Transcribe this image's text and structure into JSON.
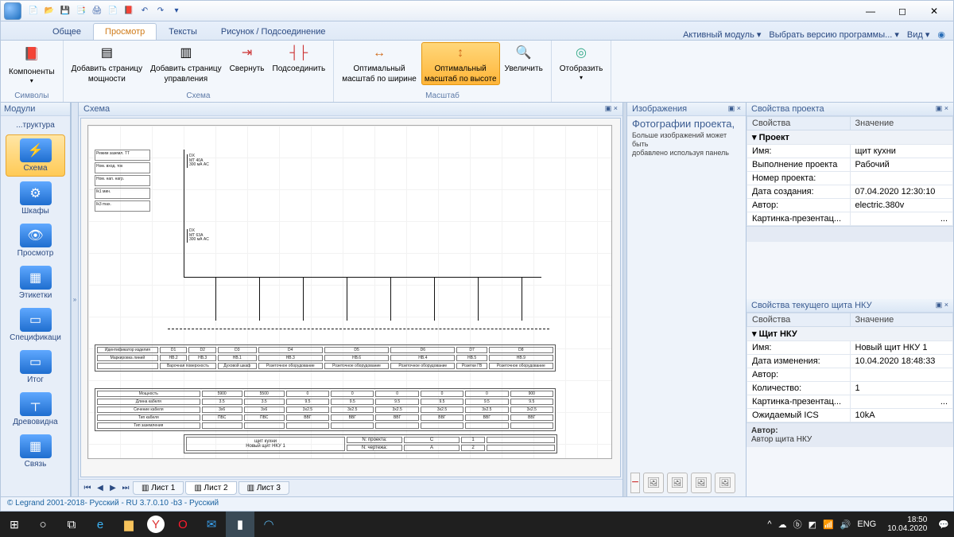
{
  "titlebar": {
    "qat": [
      "📄",
      "📂",
      "💾",
      "📑",
      "🖨",
      "📄",
      "📕",
      "↶",
      "↷"
    ]
  },
  "tabs": {
    "t1": "Общее",
    "t2": "Просмотр",
    "t3": "Тексты",
    "t4": "Рисунок / Подсоединение"
  },
  "tabright": {
    "a": "Активный модуль",
    "b": "Выбрать версию программы...",
    "c": "Вид"
  },
  "ribbon": {
    "g1": {
      "label": "Символы",
      "btn1top": "Компоненты",
      "btn1bot": ""
    },
    "g2": {
      "label": "Схема",
      "b1a": "Добавить страницу",
      "b1b": "мощности",
      "b2a": "Добавить страницу",
      "b2b": "управления",
      "b3": "Свернуть",
      "b4": "Подсоединить"
    },
    "g3": {
      "label": "Масштаб",
      "b1a": "Оптимальный",
      "b1b": "масштаб по ширине",
      "b2a": "Оптимальный",
      "b2b": "масштаб по высоте",
      "b3": "Увеличить"
    },
    "g4": {
      "b1": "Отобразить"
    }
  },
  "modules": {
    "title": "Модули",
    "m0": "...труктура",
    "m1": "Схема",
    "m2": "Шкафы",
    "m3": "Просмотр",
    "m4": "Этикетки",
    "m5": "Спецификаци",
    "m6": "Итог",
    "m7": "Древовидна",
    "m8": "Связь"
  },
  "center": {
    "title": "Схема",
    "sheet1": "Лист 1",
    "sheet2": "Лист 2",
    "sheet3": "Лист 3",
    "tb_name": "щит кухни",
    "tb_sub": "Новый щит НКУ 1",
    "tb_np": "N: проекта:",
    "tb_nc": "N: чертежа:",
    "side0": "Режим заземл.    TT",
    "side1": "Ном. вход. ток",
    "side2": "Ном. нап. нагр.",
    "side3": "Ik1 мин.",
    "side4": "Ik3 max.",
    "col0": "Идентификатор изделия",
    "col1": "Маркировка линий",
    "col2": "",
    "col3": "Мощность",
    "col4": "Длина кабеля",
    "col5": "Сечение кабеля",
    "col6": "Тип кабеля",
    "col7": "Тип заземления"
  },
  "images": {
    "header": "Изображения",
    "big": "Фотографии проекта,",
    "l1": "Больше изображений может быть",
    "l2": "добавлено используя панель"
  },
  "props1": {
    "title": "Свойства проекта",
    "hprop": "Свойства",
    "hval": "Значение",
    "group": "Проект",
    "r1": "Имя:",
    "v1": "щит кухни",
    "r2": "Выполнение проекта",
    "v2": "Рабочий",
    "r3": "Номер проекта:",
    "v3": "",
    "r4": "Дата создания:",
    "v4": "07.04.2020 12:30:10",
    "r5": "Автор:",
    "v5": "electric.380v",
    "r6": "Картинка-презентац...",
    "v6": "..."
  },
  "props2": {
    "title": "Свойства текущего щита НКУ",
    "hprop": "Свойства",
    "hval": "Значение",
    "group": "Щит НКУ",
    "r1": "Имя:",
    "v1": "Новый щит НКУ 1",
    "r2": "Дата изменения:",
    "v2": "10.04.2020 18:48:33",
    "r3": "Автор:",
    "v3": "",
    "r4": "Количество:",
    "v4": "1",
    "r5": "Картинка-презентац...",
    "v5": "...",
    "r6": "Ожидаемый ICS",
    "v6": "10kA",
    "ftitle": "Автор:",
    "fsub": "Автор щита НКУ"
  },
  "status": "© Legrand 2001-2018- Русский - RU 3.7.0.10 -b3 - Русский",
  "taskbar": {
    "lang": "ENG",
    "time": "18:50",
    "date": "10.04.2020"
  }
}
